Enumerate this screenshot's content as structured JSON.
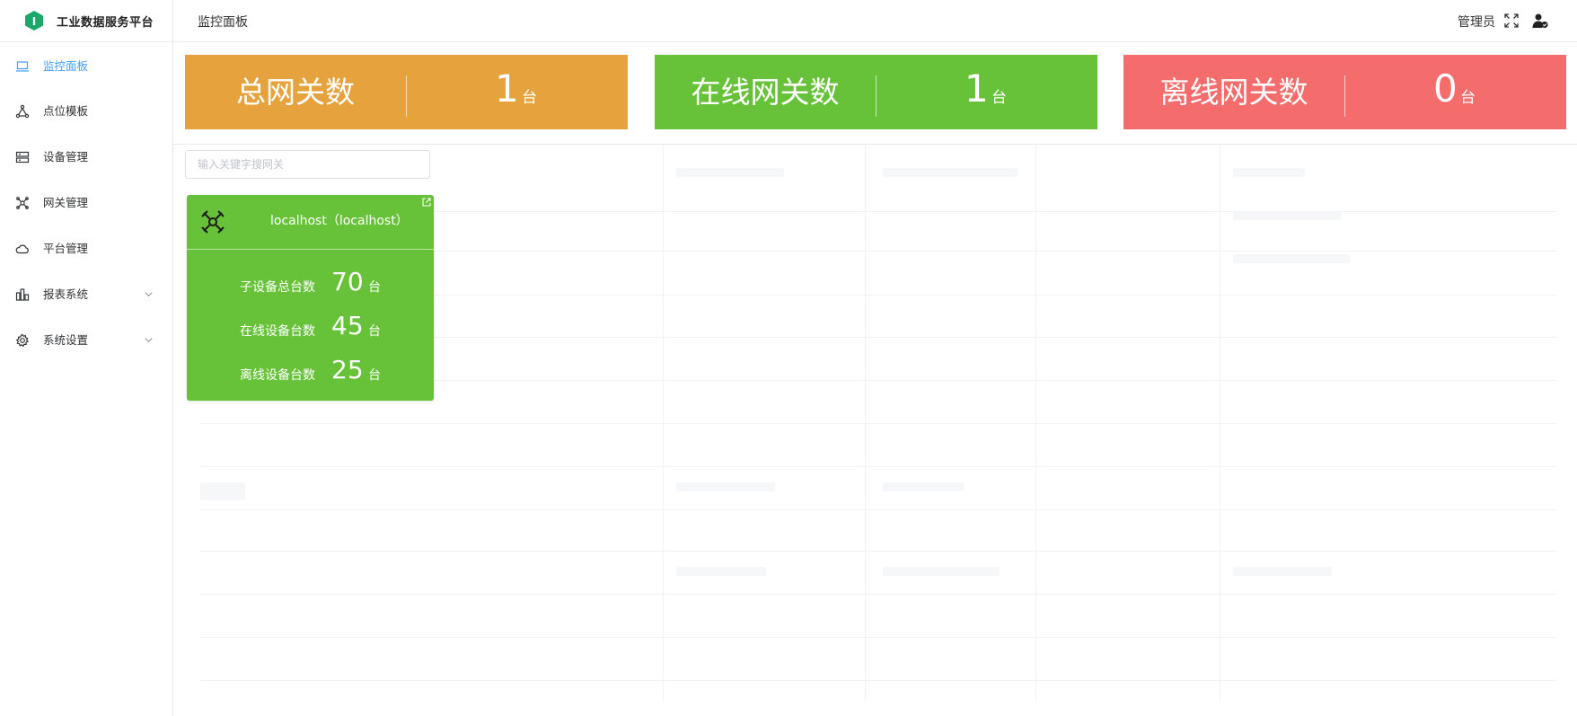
{
  "app": {
    "title": "工业数据服务平台",
    "logo_letter": "I"
  },
  "sidebar": {
    "items": [
      {
        "label": "监控面板",
        "icon": "monitor-icon",
        "active": true
      },
      {
        "label": "点位模板",
        "icon": "nodes-icon"
      },
      {
        "label": "设备管理",
        "icon": "server-icon"
      },
      {
        "label": "网关管理",
        "icon": "gateway-icon"
      },
      {
        "label": "平台管理",
        "icon": "cloud-icon"
      },
      {
        "label": "报表系统",
        "icon": "bar-chart-icon",
        "expandable": true
      },
      {
        "label": "系统设置",
        "icon": "gear-icon",
        "expandable": true
      }
    ]
  },
  "header": {
    "title": "监控面板",
    "user": "管理员"
  },
  "stats": [
    {
      "label": "总网关数",
      "value": "1",
      "unit": "台",
      "color": "#e6a23c"
    },
    {
      "label": "在线网关数",
      "value": "1",
      "unit": "台",
      "color": "#67c23a"
    },
    {
      "label": "离线网关数",
      "value": "0",
      "unit": "台",
      "color": "#f56c6c"
    }
  ],
  "search": {
    "placeholder": "输入关键字搜网关",
    "value": ""
  },
  "gateway_card": {
    "title": "localhost（localhost）",
    "rows": [
      {
        "label": "子设备总台数",
        "value": "70",
        "unit": "台"
      },
      {
        "label": "在线设备台数",
        "value": "45",
        "unit": "台"
      },
      {
        "label": "离线设备台数",
        "value": "25",
        "unit": "台"
      }
    ]
  },
  "colors": {
    "accent": "#409eff",
    "brand": "#1aa86b",
    "online": "#67c23a",
    "warning": "#e6a23c",
    "offline": "#f56c6c"
  }
}
